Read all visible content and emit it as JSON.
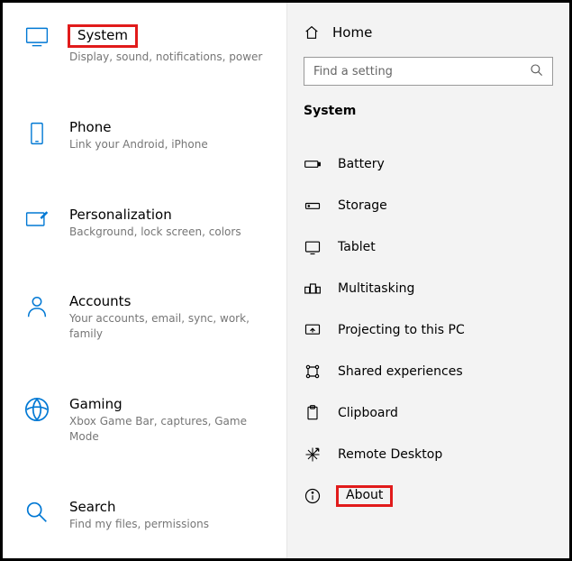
{
  "left": {
    "categories": [
      {
        "title": "System",
        "desc": "Display, sound, notifications, power",
        "highlighted": true
      },
      {
        "title": "Phone",
        "desc": "Link your Android, iPhone",
        "highlighted": false
      },
      {
        "title": "Personalization",
        "desc": "Background, lock screen, colors",
        "highlighted": false
      },
      {
        "title": "Accounts",
        "desc": "Your accounts, email, sync, work, family",
        "highlighted": false
      },
      {
        "title": "Gaming",
        "desc": "Xbox Game Bar, captures, Game Mode",
        "highlighted": false
      },
      {
        "title": "Search",
        "desc": "Find my files, permissions",
        "highlighted": false
      }
    ]
  },
  "right": {
    "home_label": "Home",
    "search_placeholder": "Find a setting",
    "section_title": "System",
    "items": [
      {
        "label": "Battery",
        "highlighted": false
      },
      {
        "label": "Storage",
        "highlighted": false
      },
      {
        "label": "Tablet",
        "highlighted": false
      },
      {
        "label": "Multitasking",
        "highlighted": false
      },
      {
        "label": "Projecting to this PC",
        "highlighted": false
      },
      {
        "label": "Shared experiences",
        "highlighted": false
      },
      {
        "label": "Clipboard",
        "highlighted": false
      },
      {
        "label": "Remote Desktop",
        "highlighted": false
      },
      {
        "label": "About",
        "highlighted": true
      }
    ]
  }
}
